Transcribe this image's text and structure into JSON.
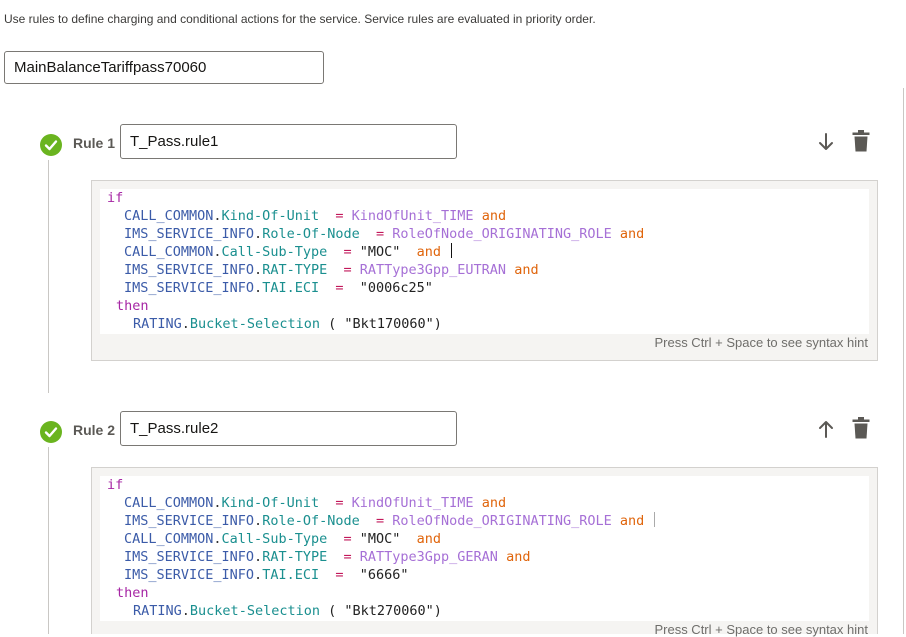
{
  "intro": "Use rules to define charging and conditional actions for the service. Service rules are evaluated in priority order.",
  "service_name": "MainBalanceTariffpass70060",
  "hint": "Press Ctrl + Space to see syntax hint",
  "colors": {
    "check": "#6ab41f",
    "keyword": "#a626a4",
    "entity": "#3b5ba8",
    "attribute": "#1a8f8f",
    "enum": "#a670d6",
    "and": "#e0650c"
  },
  "rules": [
    {
      "label": "Rule 1",
      "name": "T_Pass.rule1",
      "move_icon": "arrow-down-icon",
      "code": {
        "if": "if",
        "lines": [
          {
            "entity": "CALL_COMMON",
            "attr": "Kind-Of-Unit",
            "op": "=",
            "value": "KindOfUnit_TIME",
            "conj": "and"
          },
          {
            "entity": "IMS_SERVICE_INFO",
            "attr": "Role-Of-Node",
            "op": "=",
            "value": "RoleOfNode_ORIGINATING_ROLE",
            "conj": "and"
          },
          {
            "entity": "CALL_COMMON",
            "attr": "Call-Sub-Type",
            "op": "=",
            "value": "\"MOC\"",
            "conj": "and"
          },
          {
            "entity": "IMS_SERVICE_INFO",
            "attr": "RAT-TYPE",
            "op": "=",
            "value": "RATType3Gpp_EUTRAN",
            "conj": "and"
          },
          {
            "entity": "IMS_SERVICE_INFO",
            "attr": "TAI.ECI",
            "op": "=",
            "value": "\"0006c25\"",
            "conj": ""
          }
        ],
        "then": "then",
        "action": {
          "entity": "RATING",
          "attr": "Bucket-Selection",
          "arg": "( \"Bkt170060\")"
        }
      }
    },
    {
      "label": "Rule 2",
      "name": "T_Pass.rule2",
      "move_icon": "arrow-up-icon",
      "code": {
        "if": "if",
        "lines": [
          {
            "entity": "CALL_COMMON",
            "attr": "Kind-Of-Unit",
            "op": "=",
            "value": "KindOfUnit_TIME",
            "conj": "and"
          },
          {
            "entity": "IMS_SERVICE_INFO",
            "attr": "Role-Of-Node",
            "op": "=",
            "value": "RoleOfNode_ORIGINATING_ROLE",
            "conj": "and"
          },
          {
            "entity": "CALL_COMMON",
            "attr": "Call-Sub-Type",
            "op": "=",
            "value": "\"MOC\"",
            "conj": "and"
          },
          {
            "entity": "IMS_SERVICE_INFO",
            "attr": "RAT-TYPE",
            "op": "=",
            "value": "RATType3Gpp_GERAN",
            "conj": "and"
          },
          {
            "entity": "IMS_SERVICE_INFO",
            "attr": "TAI.ECI",
            "op": "=",
            "value": "\"6666\"",
            "conj": ""
          }
        ],
        "then": "then",
        "action": {
          "entity": "RATING",
          "attr": "Bucket-Selection",
          "arg": "( \"Bkt270060\")"
        }
      }
    }
  ]
}
